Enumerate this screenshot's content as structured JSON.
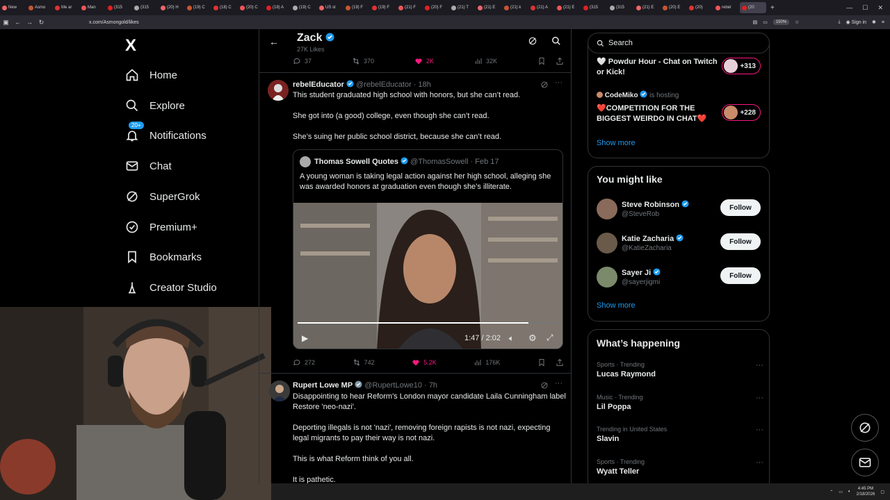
{
  "browser": {
    "tabs": [
      "New",
      "Asmo",
      "Me ar",
      "Man",
      "(315",
      "(315",
      "(20) H",
      "(19) C",
      "(18) C",
      "(20) C",
      "(18) A",
      "(19) C",
      "US st",
      "(19) F",
      "(19) F",
      "(21) F",
      "(20) F",
      "(21) T",
      "(21) E",
      "(21) k",
      "(21) A",
      "(21) E",
      "(315",
      "(315",
      "(21) E",
      "(20) E",
      "(20)",
      "rebel",
      "(20"
    ],
    "active_tab_label": "(20",
    "url": "x.com/Asmongold/likes",
    "zoom": "150%",
    "signin_label": "Sign in",
    "colors": {
      "bar": "#1c1b22",
      "urlbar": "#2b2a33"
    }
  },
  "nav": {
    "logo": "X",
    "items": [
      {
        "label": "Home",
        "icon": "home-icon"
      },
      {
        "label": "Explore",
        "icon": "search-icon"
      },
      {
        "label": "Notifications",
        "icon": "bell-icon"
      },
      {
        "label": "Chat",
        "icon": "mail-icon"
      },
      {
        "label": "SuperGrok",
        "icon": "grok-icon"
      },
      {
        "label": "Premium+",
        "icon": "verified-icon"
      },
      {
        "label": "Bookmarks",
        "icon": "bookmark-icon"
      },
      {
        "label": "Creator Studio",
        "icon": "creator-icon"
      }
    ],
    "notif_badge": "20+"
  },
  "header": {
    "name": "Zack",
    "likes": "27K Likes"
  },
  "prev_actions": {
    "replies": "37",
    "reposts": "370",
    "likes": "2K",
    "views": "32K"
  },
  "tweet1": {
    "name": "rebelEducator",
    "handle": "@rebelEducator",
    "time": "18h",
    "lines": [
      "This student graduated high school with honors, but she can’t read.",
      "She got into (a good) college, even though she can’t read.",
      "She’s suing her public school district, because she can’t read."
    ],
    "quote": {
      "name": "Thomas Sowell Quotes",
      "handle": "@ThomasSowell",
      "date": "Feb 17",
      "text": "A young woman is taking legal action against her high school, alleging she was awarded honors at graduation even though she’s illiterate.",
      "video_time": "1:47 / 2:02",
      "progress": 0.88
    },
    "actions": {
      "replies": "272",
      "reposts": "742",
      "likes": "5.2K",
      "views": "176K"
    }
  },
  "tweet2": {
    "name": "Rupert Lowe MP",
    "handle": "@RupertLowe10",
    "time": "7h",
    "lines": [
      "Disappointing to hear Reform's London mayor candidate Laila Cunningham label Restore 'neo-nazi'.",
      "Deporting illegals is not 'nazi', removing foreign rapists is not nazi, expecting legal migrants to pay their way is not nazi.",
      "This is what Reform think of you all.",
      "It is pathetic."
    ]
  },
  "sidebar": {
    "search_placeholder": "Search",
    "live": [
      {
        "title": "🤍 Powdur Hour - Chat on Twitch or  Kick!",
        "count": "+313"
      },
      {
        "host": "CodeMiko",
        "hosting": "is hosting",
        "title": "❤️COMPETITION FOR THE BIGGEST WEIRDO IN CHAT❤️",
        "count": "+228"
      }
    ],
    "show_more": "Show more",
    "wtf_title": "You might like",
    "people": [
      {
        "name": "Steve Robinson",
        "handle": "@SteveRob"
      },
      {
        "name": "Katie Zacharia",
        "handle": "@KatieZacharia"
      },
      {
        "name": "Sayer Ji",
        "handle": "@sayerjigmi"
      }
    ],
    "follow_label": "Follow",
    "happening_title": "What’s happening",
    "trends": [
      {
        "cat": "Sports · Trending",
        "topic": "Lucas Raymond"
      },
      {
        "cat": "Music · Trending",
        "topic": "Lil Poppa"
      },
      {
        "cat": "Trending in United States",
        "topic": "Slavin"
      },
      {
        "cat": "Sports · Trending",
        "topic": "Wyatt Teller"
      }
    ]
  },
  "taskbar": {
    "time": "4:45 PM",
    "date": "2/18/2026"
  },
  "accent": "#1d9bf0",
  "like_color": "#f91880"
}
